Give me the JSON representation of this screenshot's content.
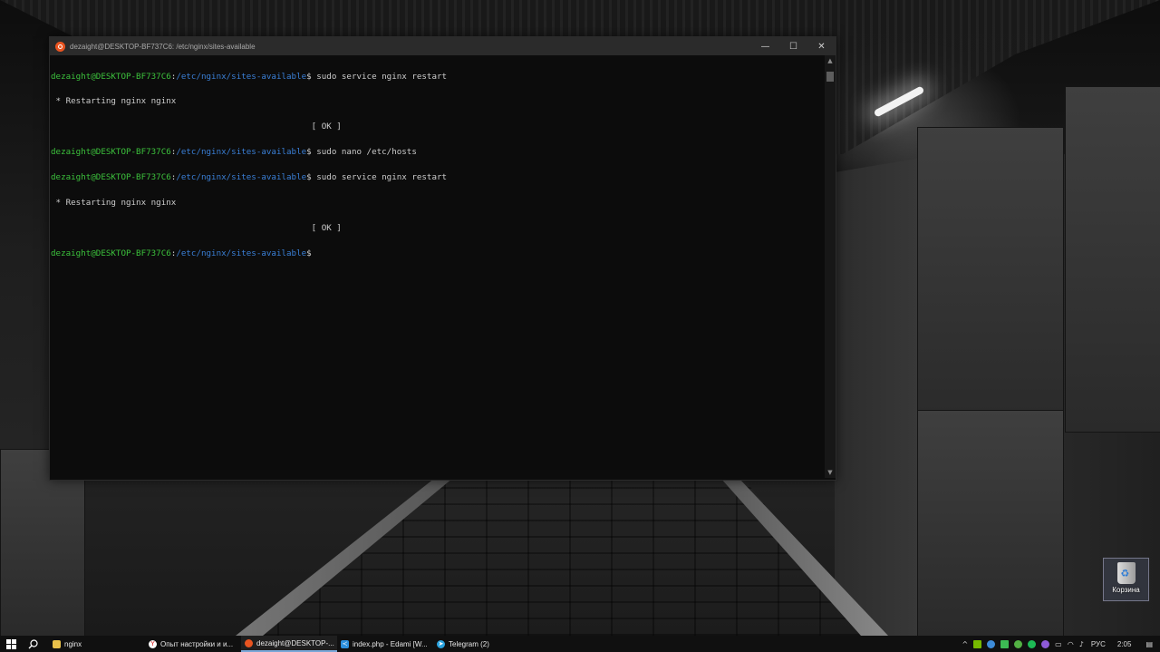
{
  "window": {
    "title": "dezaight@DESKTOP-BF737C6: /etc/nginx/sites-available",
    "controls": {
      "minimize": "—",
      "maximize": "☐",
      "close": "✕"
    }
  },
  "console": {
    "lines": [
      {
        "user": "dezaight@DESKTOP-BF737C6",
        "colon": ":",
        "path": "/etc/nginx/sites-available",
        "dollar": "$ ",
        "command": "sudo service nginx restart"
      },
      {
        "text": " * Restarting nginx nginx"
      },
      {
        "text": "                                                    [ OK ]"
      },
      {
        "user": "dezaight@DESKTOP-BF737C6",
        "colon": ":",
        "path": "/etc/nginx/sites-available",
        "dollar": "$ ",
        "command": "sudo nano /etc/hosts"
      },
      {
        "user": "dezaight@DESKTOP-BF737C6",
        "colon": ":",
        "path": "/etc/nginx/sites-available",
        "dollar": "$ ",
        "command": "sudo service nginx restart"
      },
      {
        "text": " * Restarting nginx nginx"
      },
      {
        "text": "                                                    [ OK ]"
      },
      {
        "user": "dezaight@DESKTOP-BF737C6",
        "colon": ":",
        "path": "/etc/nginx/sites-available",
        "dollar": "$",
        "command": ""
      }
    ]
  },
  "desktop": {
    "recycle_bin_label": "Корзина"
  },
  "taskbar": {
    "items": [
      {
        "label": "nginx",
        "icon": "folder-icon",
        "color": "#e8c04a"
      },
      {
        "label": "Опыт настройки и и...",
        "icon": "yandex-browser-icon",
        "color": "#ffffff"
      },
      {
        "label": "dezaight@DESKTOP-...",
        "icon": "ubuntu-icon",
        "color": "#e95420"
      },
      {
        "label": "index.php - Edami [W...",
        "icon": "vscode-icon",
        "color": "#2c8fdc"
      },
      {
        "label": "Telegram (2)",
        "icon": "telegram-icon",
        "color": "#2aa3df"
      }
    ],
    "tray": {
      "language": "РУС",
      "time": "2:05"
    }
  }
}
